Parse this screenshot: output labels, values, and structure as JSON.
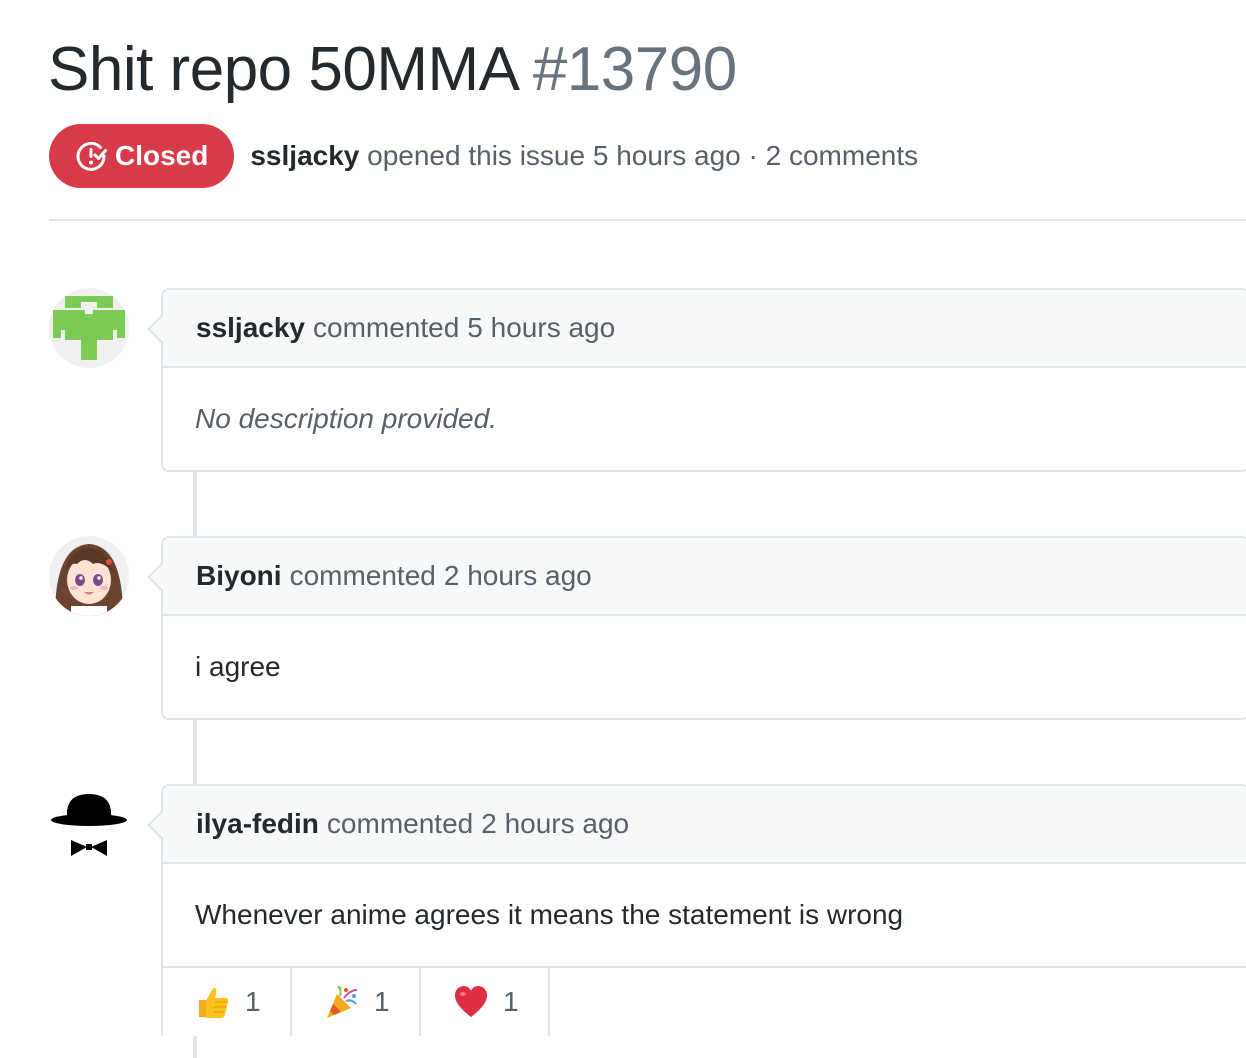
{
  "issue": {
    "title": "Shit repo 50MMA",
    "number": "#13790",
    "state": "Closed",
    "state_color": "#d73a49",
    "author": "ssljacky",
    "meta": "opened this issue 5 hours ago · 2 comments"
  },
  "comments": [
    {
      "author": "ssljacky",
      "action": "commented",
      "time": "5 hours ago",
      "body": "No description provided.",
      "avatar_icon": "identicon-avatar"
    },
    {
      "author": "Biyoni",
      "action": "commented",
      "time": "2 hours ago",
      "body": "i agree",
      "avatar_icon": "anime-girl-avatar"
    },
    {
      "author": "ilya-fedin",
      "action": "commented",
      "time": "2 hours ago",
      "body": "Whenever anime agrees it means the statement is wrong",
      "avatar_icon": "hat-bowtie-avatar",
      "reactions": [
        {
          "icon": "thumbs-up-icon",
          "count": "1"
        },
        {
          "icon": "party-popper-icon",
          "count": "1"
        },
        {
          "icon": "heart-icon",
          "count": "1"
        }
      ]
    }
  ]
}
